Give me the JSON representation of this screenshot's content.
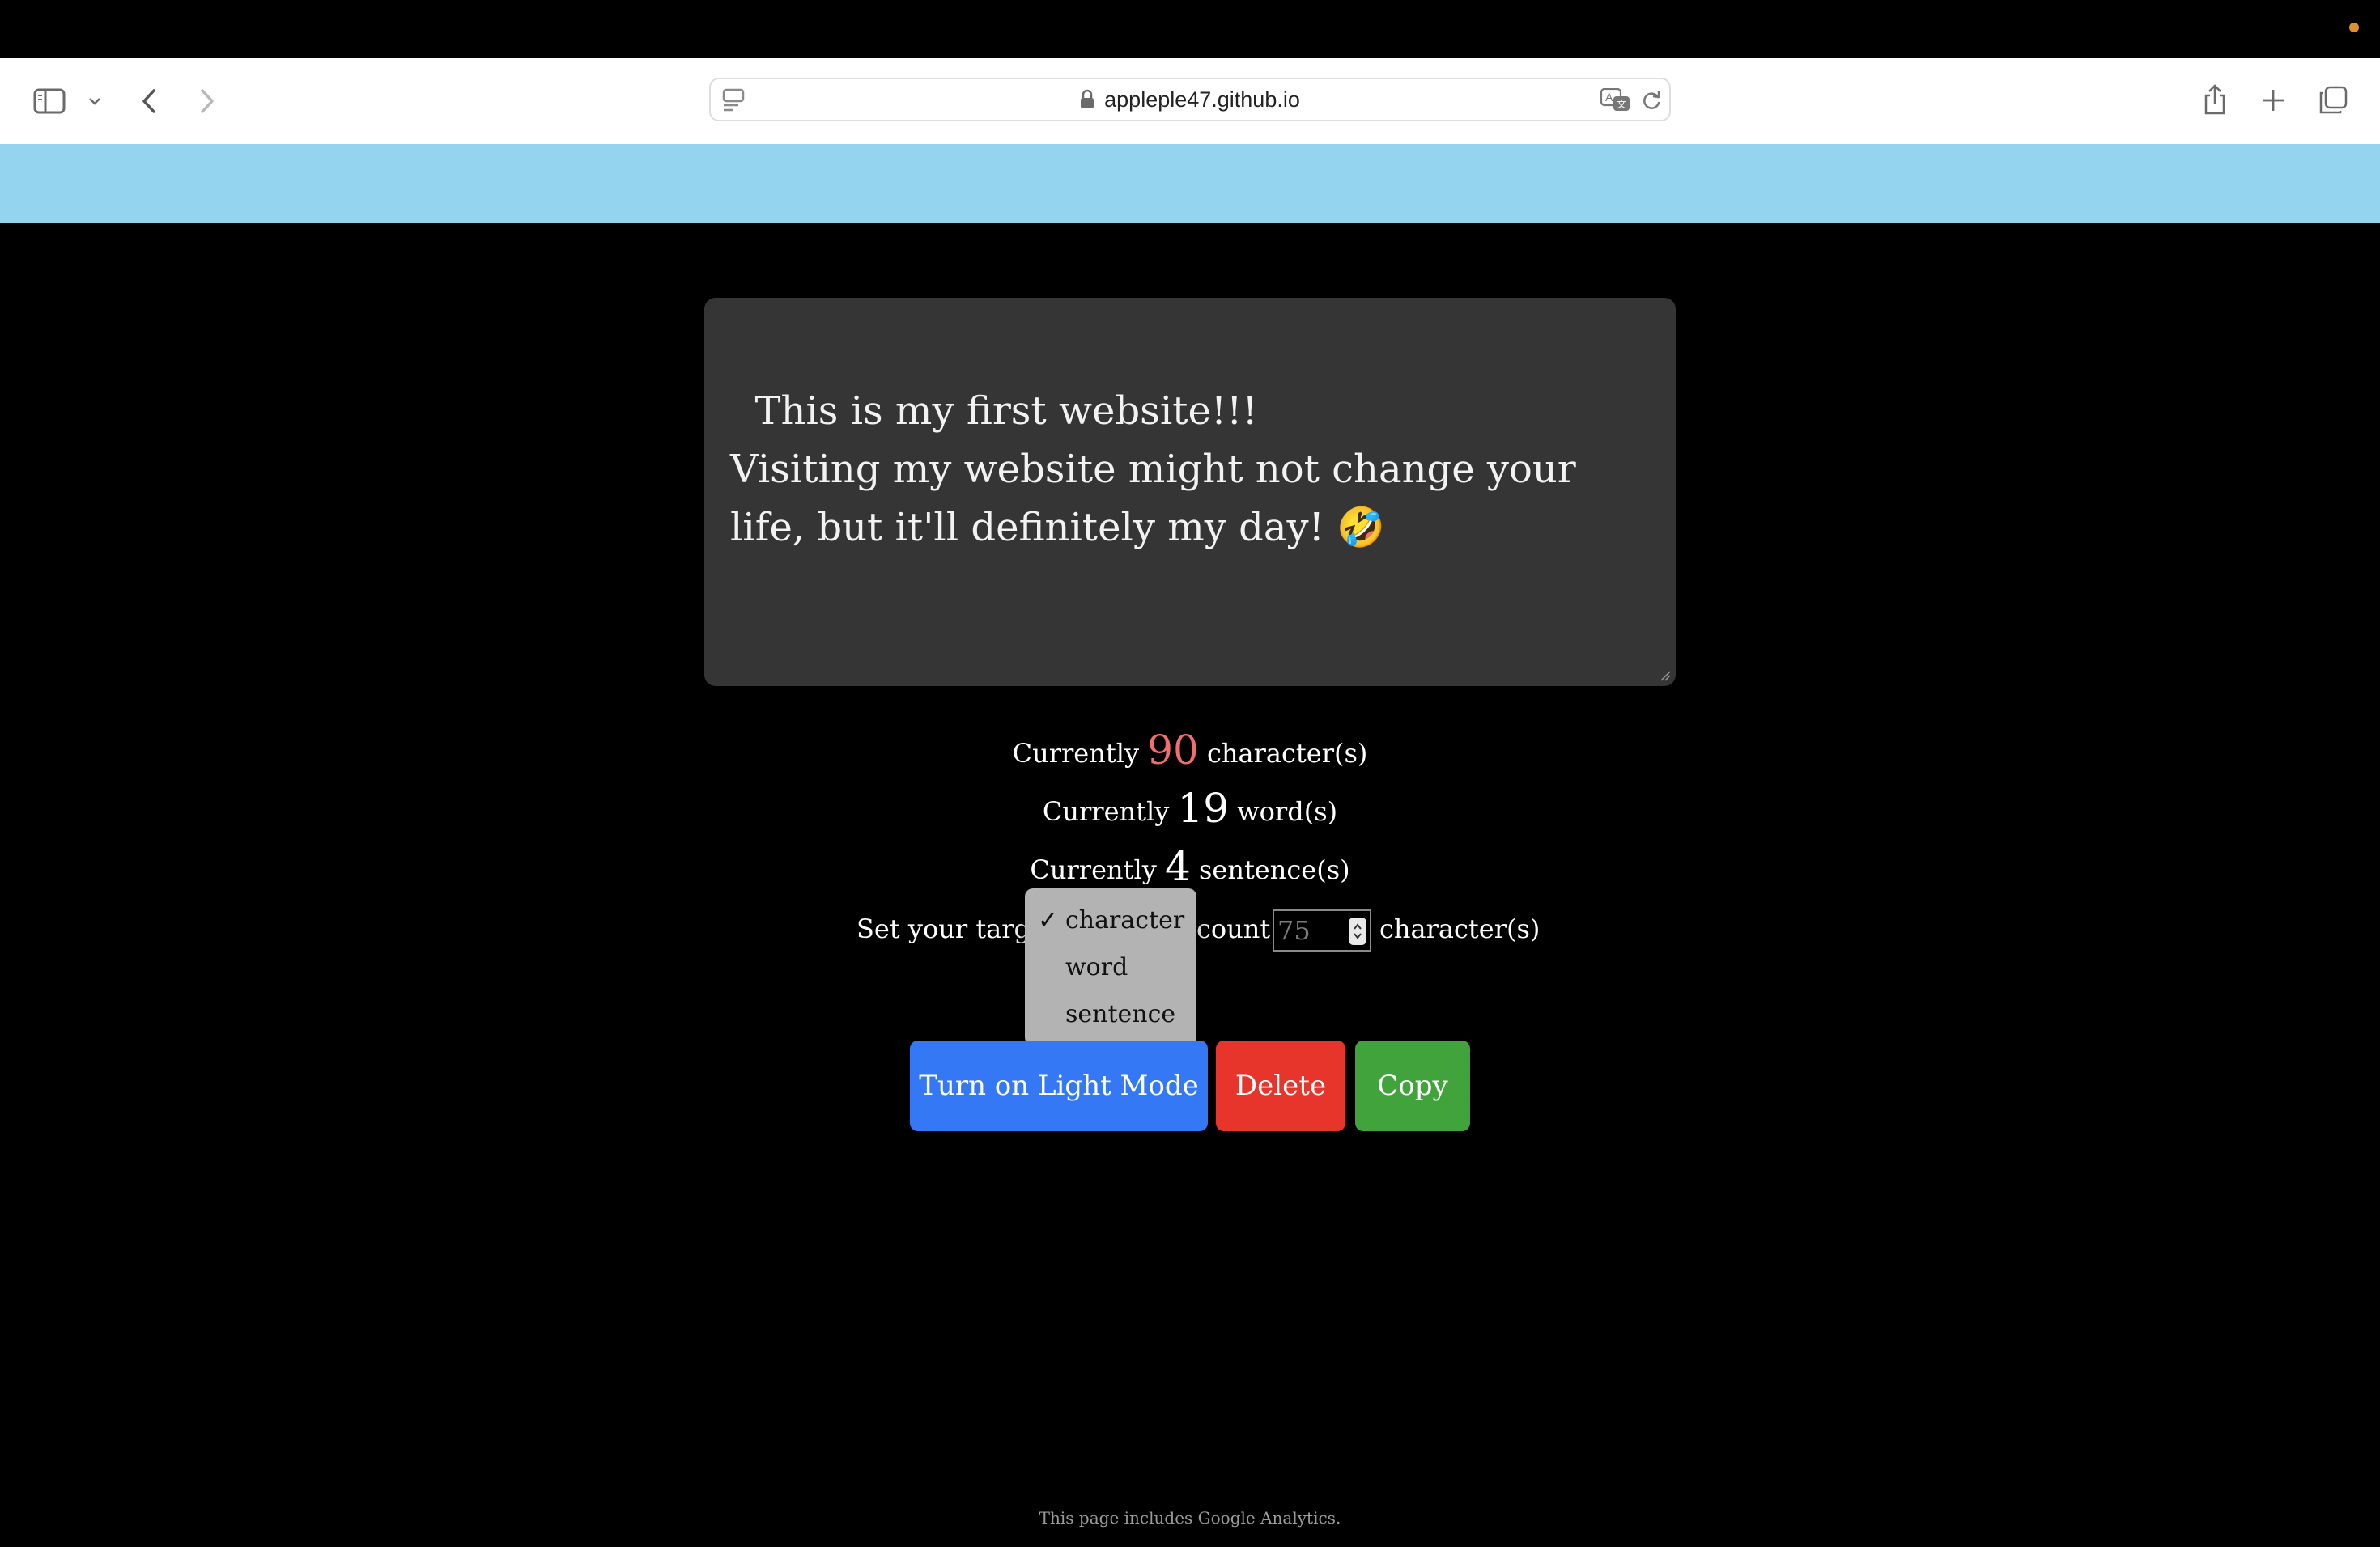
{
  "browser": {
    "url": "appleple47.github.io",
    "icons": [
      "sidebar-icon",
      "chevron-down-icon",
      "back-icon",
      "forward-icon",
      "reader-icon",
      "lock-icon",
      "translate-icon",
      "reload-icon",
      "share-icon",
      "new-tab-icon",
      "tab-overview-icon"
    ]
  },
  "editor": {
    "text": "This is my first website!!!\nVisiting my website might not change your life, but it'll definitely my day! 🤣"
  },
  "stats": {
    "prefix": "Currently",
    "characters": {
      "count": "90",
      "unit": "character(s)"
    },
    "words": {
      "count": "19",
      "unit": "word(s)"
    },
    "sentences": {
      "count": "4",
      "unit": "sentence(s)"
    }
  },
  "target": {
    "label_left": "Set your targe",
    "label_right": "count:",
    "input_placeholder": "75",
    "unit": "character(s)"
  },
  "select": {
    "selected": "character",
    "options": [
      "character",
      "word",
      "sentence"
    ],
    "check": "✓"
  },
  "buttons": {
    "light_mode": "Turn on Light Mode",
    "delete": "Delete",
    "copy": "Copy"
  },
  "colors": {
    "light_mode_button": "#3478f6",
    "delete_button": "#e8352b",
    "copy_button": "#41a33b",
    "character_count": "#f26d6d",
    "banner": "#95d4ef"
  },
  "footer": "This page includes Google Analytics."
}
